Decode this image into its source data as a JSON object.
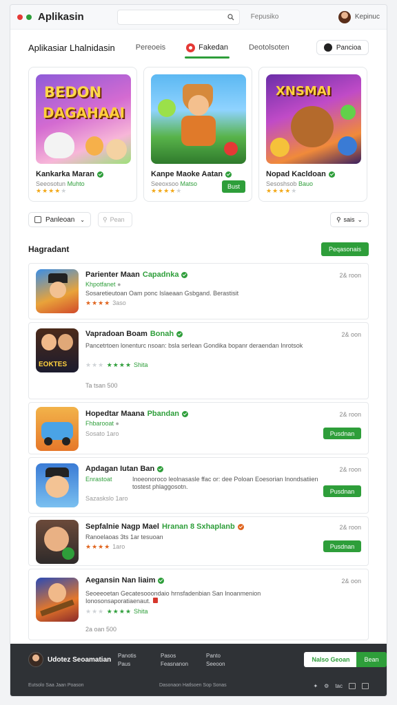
{
  "app": {
    "brand": "Aplikasin",
    "top_link": "Fepusiko",
    "user_name": "Kepinuc"
  },
  "nav": {
    "title": "Aplikasiar Lhalnidasin",
    "tabs": [
      {
        "label": "Pereoeis"
      },
      {
        "label": "Fakedan"
      },
      {
        "label": "Deotolsoten"
      }
    ],
    "pill": "Pancioa"
  },
  "featured": [
    {
      "art_text_1": "BEDON",
      "art_text_2": "DAGAHAAI",
      "name": "Kankarka Maran",
      "sub": "Seeosotun",
      "sub_green": "Muhto",
      "rating": 4,
      "button": ""
    },
    {
      "art_text_1": "",
      "art_text_2": "",
      "name": "Kanpe Maoke Aatan",
      "sub": "Seeoxsoo",
      "sub_green": "Matso",
      "rating": 4,
      "button": "Bust"
    },
    {
      "art_text_1": "XNSMAI",
      "art_text_2": "",
      "name": "Nopad Kacldoan",
      "sub": "Sesoshsob",
      "sub_green": "Bauo",
      "rating": 4,
      "button": ""
    }
  ],
  "filters": {
    "select": "Panleoan",
    "search_placeholder": "Pean",
    "sort": "sais"
  },
  "section": {
    "title": "Hagradant",
    "button": "Peqasonais"
  },
  "apps": [
    {
      "title": "Parienter Maan",
      "title_green": "Capadnka",
      "sub": "Khpotfanet",
      "desc": "Sosaretieutoan Oam ponc Islaeaan Gsbgand. Berastisit",
      "rating": 4,
      "rating_label": "3aso",
      "time": "2& roon",
      "button": "",
      "footer": ""
    },
    {
      "title": "Vapradoan Boam",
      "title_green": "Bonah",
      "sub": "",
      "desc": "Pancetrtoen lonenturc nsoan: bsla serlean Gondika bopanr deraendan Inrotsok",
      "rating": 4,
      "rating_label": "Shita",
      "time": "2& oon",
      "button": "",
      "footer": "Ta tsan 500"
    },
    {
      "title": "Hopedtar Maana",
      "title_green": "Pbandan",
      "sub": "Fhbarooat",
      "desc": "",
      "rating": 0,
      "rating_label": "Sosato 1aro",
      "time": "2& roon",
      "button": "Pusdnan",
      "footer": ""
    },
    {
      "title": "Apdagan Iutan Ban",
      "title_green": "",
      "sub": "Enrastoat",
      "desc": "Inoeonoroco leolnasasle ffac or: dee Poloan Eoesorian Inondsatiien tostest phlaggosotn.",
      "rating": 0,
      "rating_label": "Sazaskslo 1aro",
      "time": "2& roon",
      "button": "Pusdnan",
      "footer": ""
    },
    {
      "title": "Sepfalnie Nagp Mael",
      "title_green": "Hranan 8 Sxhaplanb",
      "sub": "",
      "desc": "Ranoelaoas 3ts 1ar tesuoan",
      "rating": 4,
      "rating_label": "1aro",
      "time": "2& roon",
      "button": "Pusdnan",
      "footer": ""
    },
    {
      "title": "Aegansin Nan liaim",
      "title_green": "",
      "sub": "",
      "desc": "Seoeeoetan Gecatesooondaio hrnsfadenbian San Inoanmenion Ionosonsaporatiaenaut.",
      "rating": 4,
      "rating_label": "Shita",
      "time": "2& oon",
      "button": "",
      "footer": "2a oan 500"
    }
  ],
  "footer": {
    "name": "Udotez Seoamatian",
    "col1": [
      "Panotis",
      "Paus"
    ],
    "col2": [
      "Pasos",
      "Feasnanon"
    ],
    "col3": [
      "Panto",
      "Seeoon"
    ],
    "btn_primary": "Nalso Geoan",
    "btn_secondary": "Bean",
    "copyright": "Eutsolo  Saa  Jaan  Poason",
    "center": "Dasonaon Hatlsoen Sop Sonas",
    "icon_label": "tac"
  },
  "colors": {
    "accent": "#2e9e3a",
    "star": "#f2a818",
    "footer_bg": "#2f3236"
  }
}
